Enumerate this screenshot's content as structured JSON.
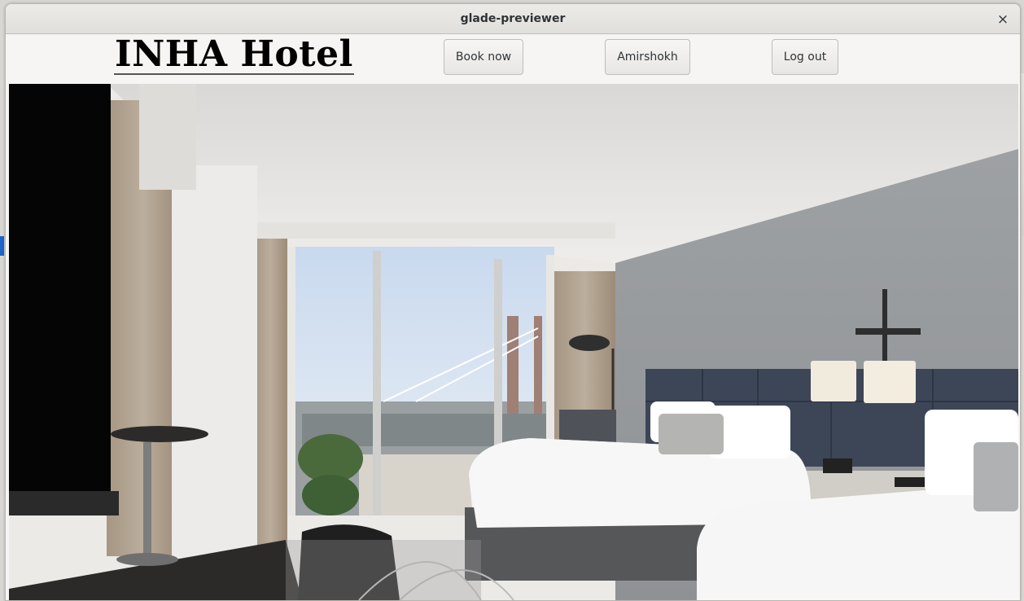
{
  "window": {
    "title": "glade-previewer",
    "close_glyph": "×"
  },
  "header": {
    "logo": "INHA Hotel",
    "book_label": "Book now",
    "user_label": "Amirshokh",
    "logout_label": "Log out"
  },
  "hero": {
    "alt": "Hotel room with two beds and a window view"
  },
  "colors": {
    "accent": "#1f64c8",
    "window_bg": "#f6f5f4"
  },
  "icons": {
    "close": "close-icon"
  }
}
